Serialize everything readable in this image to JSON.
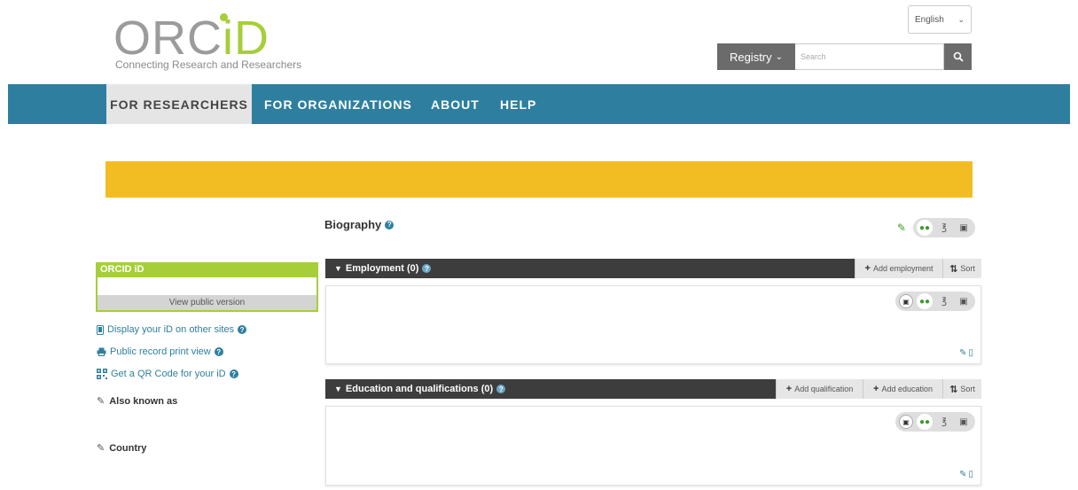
{
  "header": {
    "logo_word_orc": "ORC",
    "logo_word_id": "iD",
    "tagline": "Connecting Research and Researchers",
    "language": "English",
    "registry_label": "Registry",
    "search_placeholder": "Search"
  },
  "nav": {
    "items": [
      {
        "label": "FOR RESEARCHERS"
      },
      {
        "label": "FOR ORGANIZATIONS"
      },
      {
        "label": "ABOUT"
      },
      {
        "label": "HELP"
      }
    ]
  },
  "sidebar": {
    "orcid_label": "ORCID iD",
    "view_public": "View public version",
    "links": [
      {
        "label": "Display your iD on other sites",
        "icon": "mobile-icon"
      },
      {
        "label": "Public record print view",
        "icon": "print-icon"
      },
      {
        "label": "Get a QR Code for your iD",
        "icon": "qr-code-icon"
      }
    ],
    "also_known_as": "Also known as",
    "country": "Country"
  },
  "main": {
    "biography_title": "Biography",
    "employment": {
      "title": "Employment (0)",
      "add_label": "Add employment",
      "sort_label": "Sort"
    },
    "education": {
      "title": "Education and qualifications (0)",
      "add_qualification": "Add qualification",
      "add_education": "Add education",
      "sort_label": "Sort"
    }
  },
  "colors": {
    "nav": "#2e7f9f",
    "banner": "#f2bd22",
    "orcid_green": "#a6ce39",
    "section_bar": "#3d3d3d"
  }
}
